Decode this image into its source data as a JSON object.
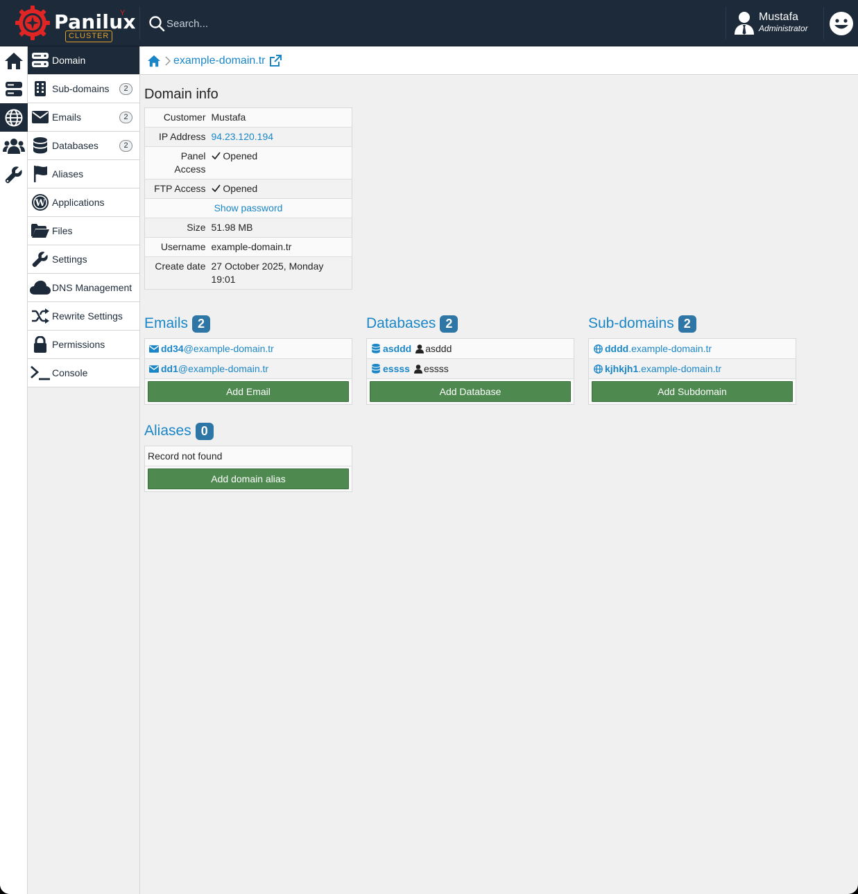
{
  "app": {
    "brand": "Panilux",
    "brand_sup": "Y",
    "edition": "CLUSTER",
    "search_placeholder": "Search...",
    "user_name": "Mustafa",
    "user_role": "Administrator"
  },
  "colors": {
    "topbar": "#1c2a39",
    "accent": "#1a86c8",
    "badge": "#2d76a5",
    "button": "#4e8a50",
    "logo_red": "#e02525",
    "cluster_orange": "#e5a52b"
  },
  "icon_column": [
    {
      "icon": "home-icon"
    },
    {
      "icon": "server-icon"
    },
    {
      "icon": "globe-icon",
      "active": true
    },
    {
      "icon": "users-icon"
    },
    {
      "icon": "wrench-icon"
    }
  ],
  "menu": [
    {
      "label": "Domain",
      "icon": "server-icon",
      "active": true
    },
    {
      "label": "Sub-domains",
      "icon": "building-icon",
      "badge": "2"
    },
    {
      "label": "Emails",
      "icon": "envelope-icon",
      "badge": "2"
    },
    {
      "label": "Databases",
      "icon": "database-icon",
      "badge": "2"
    },
    {
      "label": "Aliases",
      "icon": "flag-icon"
    },
    {
      "label": "Applications",
      "icon": "wordpress-icon"
    },
    {
      "label": "Files",
      "icon": "folder-open-icon"
    },
    {
      "label": "Settings",
      "icon": "wrench-icon"
    },
    {
      "label": "DNS Management",
      "icon": "cloud-icon"
    },
    {
      "label": "Rewrite Settings",
      "icon": "shuffle-icon"
    },
    {
      "label": "Permissions",
      "icon": "lock-icon"
    },
    {
      "label": "Console",
      "icon": "terminal-icon"
    }
  ],
  "breadcrumb": {
    "domain": "example-domain.tr"
  },
  "domain_info": {
    "title": "Domain info",
    "customer_label": "Customer",
    "customer": "Mustafa",
    "ip_label": "IP Address",
    "ip": "94.23.120.194",
    "panel_label_1": "Panel",
    "panel_label_2": "Access",
    "panel_value": "Opened",
    "ftp_label": "FTP Access",
    "ftp_value": "Opened",
    "show_password": "Show password",
    "size_label": "Size",
    "size": "51.98 MB",
    "username_label": "Username",
    "username": "example-domain.tr",
    "create_label": "Create date",
    "create_1": "27 October 2025, Monday",
    "create_2": "19:01"
  },
  "emails": {
    "title": "Emails",
    "count": "2",
    "items": [
      {
        "user": "dd34",
        "domain": "@example-domain.tr"
      },
      {
        "user": "dd1",
        "domain": "@example-domain.tr"
      }
    ],
    "button": "Add Email"
  },
  "databases": {
    "title": "Databases",
    "count": "2",
    "items": [
      {
        "name": "asddd",
        "user": "asddd"
      },
      {
        "name": "essss",
        "user": "essss"
      }
    ],
    "button": "Add Database"
  },
  "subdomains": {
    "title": "Sub-domains",
    "count": "2",
    "items": [
      {
        "sub": "dddd",
        "domain": ".example-domain.tr"
      },
      {
        "sub": "kjhkjh1",
        "domain": ".example-domain.tr"
      }
    ],
    "button": "Add Subdomain"
  },
  "aliases": {
    "title": "Aliases",
    "count": "0",
    "empty": "Record not found",
    "button": "Add domain alias"
  }
}
